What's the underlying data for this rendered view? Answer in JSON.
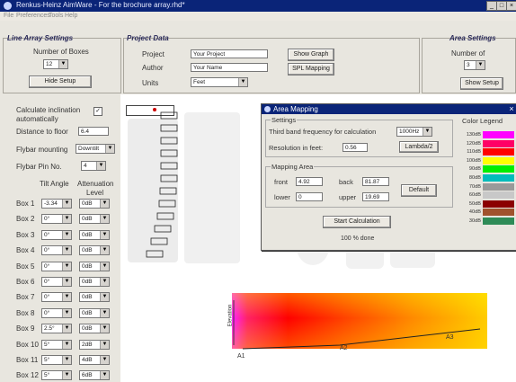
{
  "app": {
    "title": "Renkus-Heinz AimWare  -  For the brochure array.rhd*",
    "menu": [
      "File",
      "Preferences",
      "Tools",
      "Help"
    ]
  },
  "line_array": {
    "header": "Line Array Settings",
    "num_boxes_label": "Number of Boxes",
    "num_boxes": "12",
    "hide_setup": "Hide Setup",
    "calc_incl_label_1": "Calculate inclination",
    "calc_incl_label_2": "automatically",
    "calc_incl_checked": "✓",
    "distance_label": "Distance to floor",
    "distance_value": "6.4",
    "flybar_mounting_label": "Flybar mounting",
    "flybar_mounting_value": "Downtilt",
    "flybar_pin_label": "Flybar Pin No.",
    "flybar_pin_value": "4",
    "col_tilt": "Tilt Angle",
    "col_att_1": "Attenuation",
    "col_att_2": "Level",
    "boxes": [
      {
        "label": "Box 1",
        "tilt": "-3.34",
        "level": "0dB"
      },
      {
        "label": "Box 2",
        "tilt": "0°",
        "level": "0dB"
      },
      {
        "label": "Box 3",
        "tilt": "0°",
        "level": "0dB"
      },
      {
        "label": "Box 4",
        "tilt": "0°",
        "level": "0dB"
      },
      {
        "label": "Box 5",
        "tilt": "0°",
        "level": "0dB"
      },
      {
        "label": "Box 6",
        "tilt": "0°",
        "level": "0dB"
      },
      {
        "label": "Box 7",
        "tilt": "0°",
        "level": "0dB"
      },
      {
        "label": "Box 8",
        "tilt": "0°",
        "level": "0dB"
      },
      {
        "label": "Box 9",
        "tilt": "2.5°",
        "level": "0dB"
      },
      {
        "label": "Box 10",
        "tilt": "5°",
        "level": "2dB"
      },
      {
        "label": "Box 11",
        "tilt": "5°",
        "level": "4dB"
      },
      {
        "label": "Box 12",
        "tilt": "5°",
        "level": "6dB"
      }
    ]
  },
  "project": {
    "header": "Project Data",
    "project_label": "Project",
    "project_value": "Your Project",
    "author_label": "Author",
    "author_value": "Your Name",
    "units_label": "Units",
    "units_value": "Feet",
    "show_graph": "Show Graph",
    "spl_mapping": "SPL Mapping"
  },
  "area": {
    "header": "Area Settings",
    "number_label": "Number of",
    "number_value": "3",
    "show_setup": "Show Setup"
  },
  "dialog": {
    "title": "Area Mapping",
    "settings_label": "Settings",
    "third_band_label": "Third band frequency for calculation",
    "third_band_value": "1000Hz",
    "resolution_label": "Resolution in feet:",
    "resolution_value": "0.56",
    "lambda_btn": "Lambda/2",
    "mapping_area_label": "Mapping Area",
    "front_label": "front",
    "front_value": "4.92",
    "back_label": "back",
    "back_value": "81.87",
    "lower_label": "lower",
    "lower_value": "0",
    "upper_label": "upper",
    "upper_value": "19.69",
    "default_btn": "Default",
    "start_btn": "Start Calculation",
    "progress_text": "100 % done",
    "progress": 1.0,
    "legend_title": "Color Legend",
    "legend": [
      {
        "label": "130dB",
        "color": "#ff00ff"
      },
      {
        "label": "120dB",
        "color": "#ff0066"
      },
      {
        "label": "110dB",
        "color": "#ff0000"
      },
      {
        "label": "100dB",
        "color": "#ffff00"
      },
      {
        "label": "90dB",
        "color": "#00ee00"
      },
      {
        "label": "80dB",
        "color": "#00bcbc"
      },
      {
        "label": "70dB",
        "color": "#9a9a9a"
      },
      {
        "label": "60dB",
        "color": "#c8c8c8"
      },
      {
        "label": "50dB",
        "color": "#8b0000"
      },
      {
        "label": "40dB",
        "color": "#a0522d"
      },
      {
        "label": "30dB",
        "color": "#2e8b57"
      }
    ]
  },
  "spl_plot": {
    "axis_label": "Elevation",
    "points": [
      "A1",
      "A2",
      "A3"
    ]
  },
  "colors": {
    "titlebar": "#0a2478",
    "panel": "#e8e6df",
    "header_text": "#2b2b5a"
  }
}
